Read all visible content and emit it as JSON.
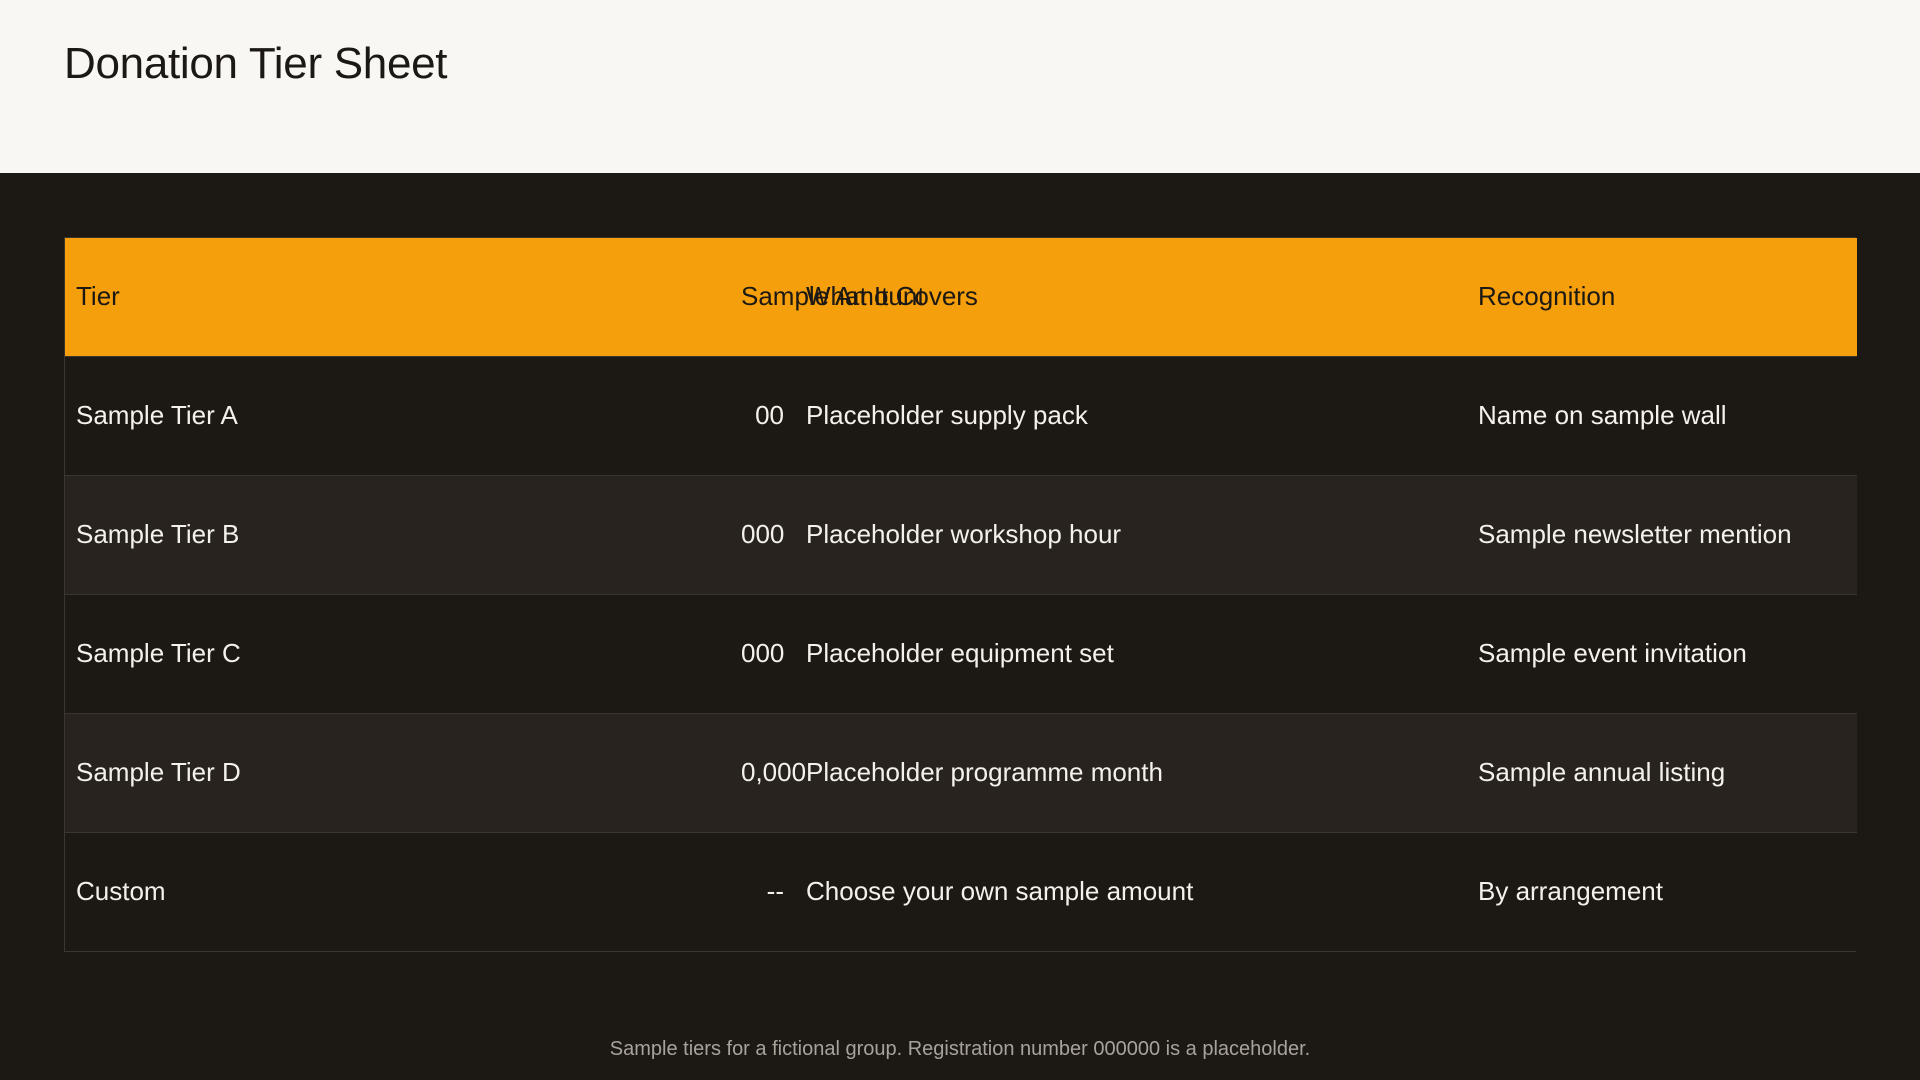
{
  "header": {
    "title": "Donation Tier Sheet"
  },
  "table": {
    "columns": [
      "Tier",
      "Sample Amount",
      "What It Covers",
      "Recognition"
    ],
    "rows": [
      {
        "tier": "Sample Tier A",
        "amount": "00",
        "covers": "Placeholder supply pack",
        "recognition": "Name on sample wall"
      },
      {
        "tier": "Sample Tier B",
        "amount": "000",
        "covers": "Placeholder workshop hour",
        "recognition": "Sample newsletter mention"
      },
      {
        "tier": "Sample Tier C",
        "amount": "000",
        "covers": "Placeholder equipment set",
        "recognition": "Sample event invitation"
      },
      {
        "tier": "Sample Tier D",
        "amount": "0,000",
        "covers": "Placeholder programme month",
        "recognition": "Sample annual listing"
      },
      {
        "tier": "Custom",
        "amount": "--",
        "covers": "Choose your own sample amount",
        "recognition": "By arrangement"
      }
    ]
  },
  "footer": {
    "note": "Sample tiers for a fictional group. Registration number 000000 is a placeholder."
  },
  "colors": {
    "accent": "#f59f0c",
    "background_dark": "#1c1814",
    "row_alt": "#28231f",
    "header_band": "#f9f7f3"
  }
}
